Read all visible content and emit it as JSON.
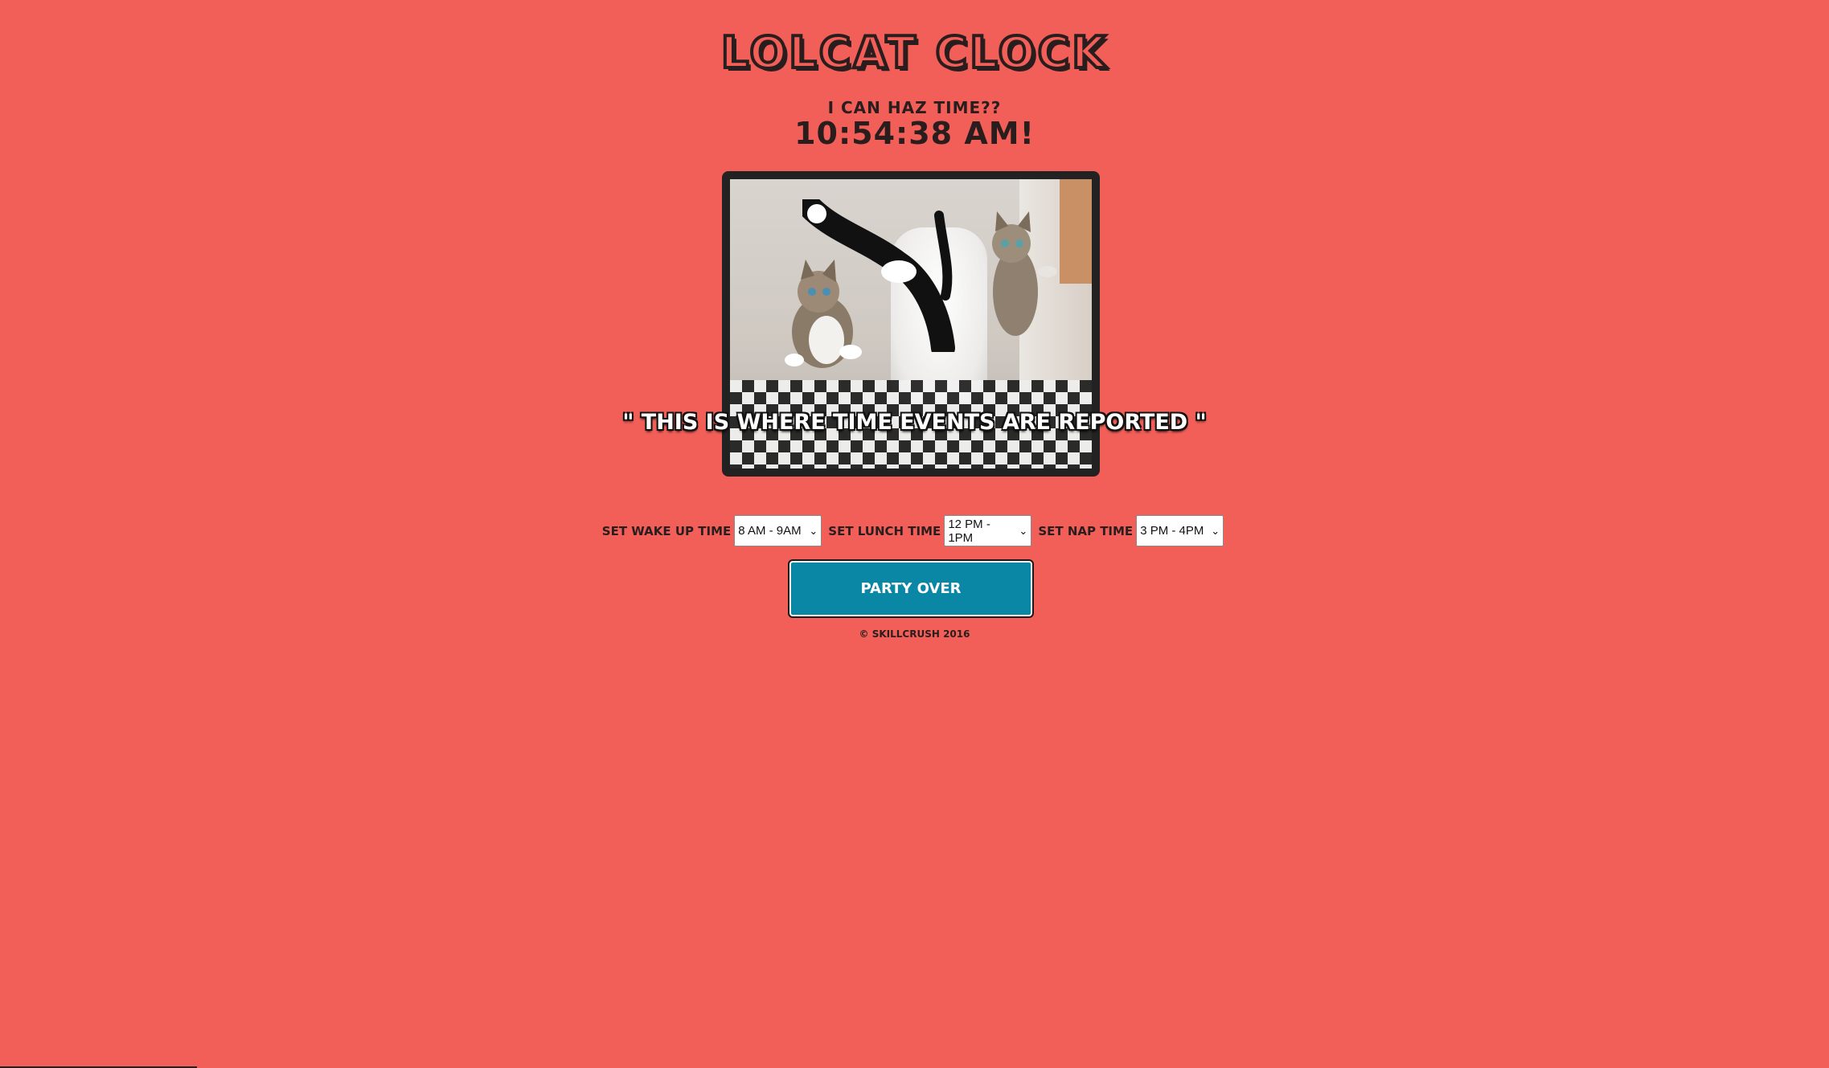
{
  "header": {
    "title": "Lolcat Clock",
    "subtitle": "I can haz time??",
    "clock": "10:54:38 AM!"
  },
  "image": {
    "caption": "\" THIS IS WHERE TIME EVENTS ARE REPORTED \""
  },
  "controls": {
    "wake_label": "Set wake up time",
    "wake_value": "8 AM - 9AM",
    "lunch_label": "Set lunch time",
    "lunch_value": "12 PM - 1PM",
    "nap_label": "Set nap time",
    "nap_value": "3 PM - 4PM"
  },
  "party_button": "Party Over",
  "footer": "© Skillcrush 2016",
  "colors": {
    "background": "#f15f58",
    "button": "#0b87a6",
    "text": "#2a1d1d"
  }
}
